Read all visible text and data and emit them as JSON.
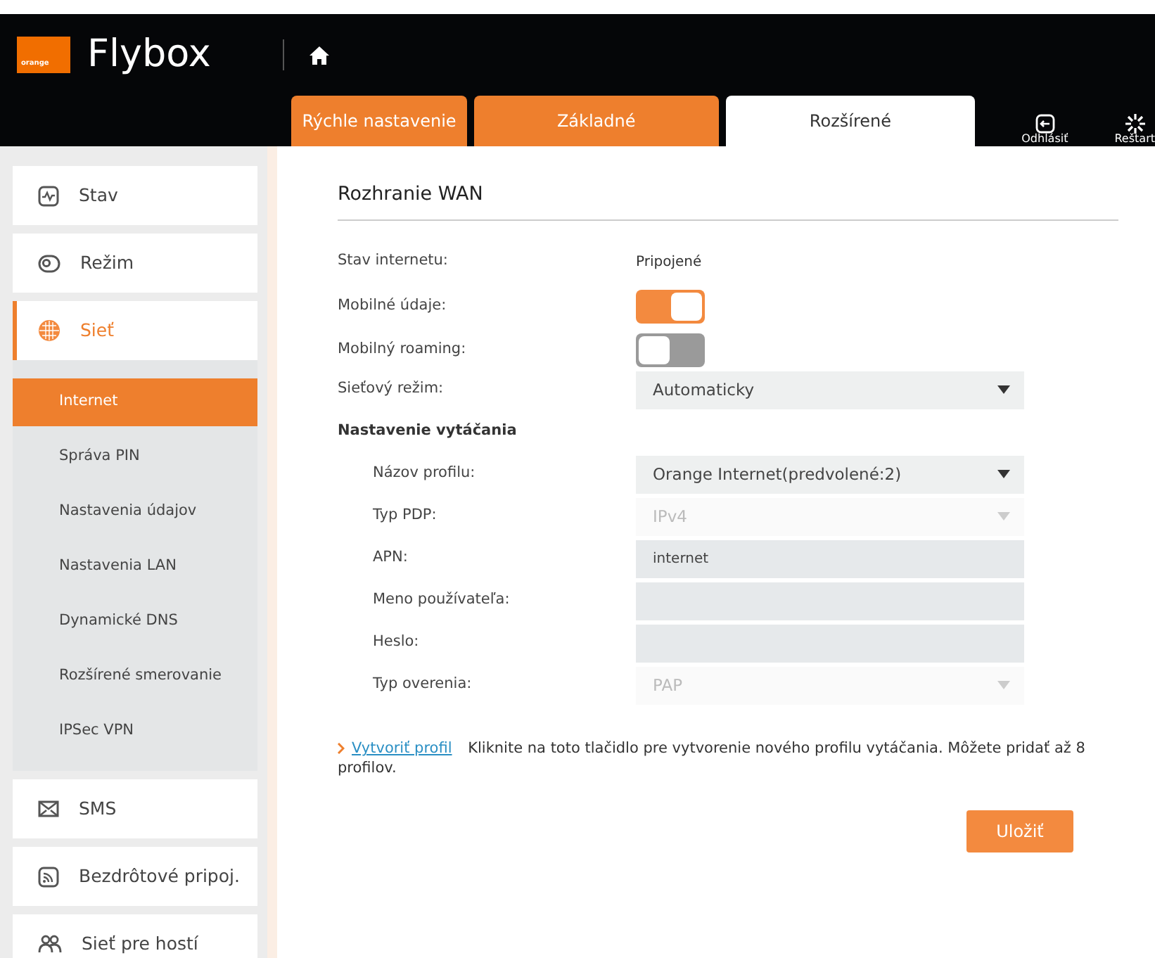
{
  "header": {
    "logo_text": "orange",
    "brand": "Flybox",
    "tabs": [
      {
        "label": "Rýchle nastavenie",
        "selected": false
      },
      {
        "label": "Základné",
        "selected": false
      },
      {
        "label": "Rozšírené",
        "selected": true
      }
    ],
    "actions": [
      {
        "kind": "logout",
        "label": "Odhlásiť"
      },
      {
        "kind": "restart",
        "label": "Reštart"
      }
    ]
  },
  "sidebar": {
    "items": [
      {
        "kind": "status",
        "label": "Stav",
        "selected": false
      },
      {
        "kind": "mode",
        "label": "Režim",
        "selected": false
      },
      {
        "kind": "network",
        "label": "Sieť",
        "selected": true,
        "expanded": true,
        "children": [
          {
            "label": "Internet",
            "selected": true
          },
          {
            "label": "Správa PIN",
            "selected": false
          },
          {
            "label": "Nastavenia údajov",
            "selected": false
          },
          {
            "label": "Nastavenia LAN",
            "selected": false
          },
          {
            "label": "Dynamické DNS",
            "selected": false
          },
          {
            "label": "Rozšírené smerovanie",
            "selected": false
          },
          {
            "label": "IPSec VPN",
            "selected": false
          }
        ]
      },
      {
        "kind": "sms",
        "label": "SMS",
        "selected": false
      },
      {
        "kind": "wireless",
        "label": "Bezdrôtové pripoj.",
        "selected": false
      },
      {
        "kind": "guest",
        "label": "Sieť pre hostí",
        "selected": false
      }
    ]
  },
  "form": {
    "title": "Rozhranie WAN",
    "fields": [
      {
        "kind": "text",
        "label": "Stav internetu:",
        "value": "Pripojené"
      },
      {
        "kind": "toggle",
        "label": "Mobilné údaje:",
        "on": true
      },
      {
        "kind": "toggle",
        "label": "Mobilný roaming:",
        "on": false
      },
      {
        "kind": "select",
        "label": "Sieťový režim:",
        "value": "Automaticky",
        "disabled": false
      },
      {
        "kind": "section",
        "label": "Nastavenie vytáčania",
        "children": [
          {
            "kind": "select",
            "label": "Názov profilu:",
            "value": "Orange Internet(predvolené:2)",
            "disabled": false
          },
          {
            "kind": "select",
            "label": "Typ PDP:",
            "value": "IPv4",
            "disabled": true
          },
          {
            "kind": "input",
            "label": "APN:",
            "value": "internet"
          },
          {
            "kind": "input",
            "label": "Meno používateľa:"
          },
          {
            "kind": "input",
            "label": "Heslo:"
          },
          {
            "kind": "select",
            "label": "Typ overenia:",
            "value": "PAP",
            "disabled": true
          }
        ]
      }
    ],
    "note": {
      "link": "Vytvoriť profil",
      "text": "Kliknite na toto tlačidlo pre vytvorenie nového profilu vytáčania. Môžete pridať až 8 profilov."
    },
    "save_button": "Uložiť"
  }
}
